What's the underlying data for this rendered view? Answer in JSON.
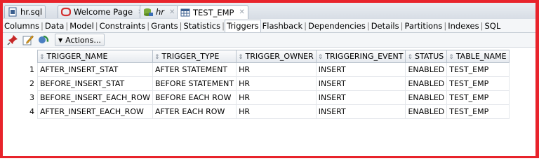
{
  "doc_tabs": [
    {
      "label": "hr.sql",
      "icon": "sql-file-icon"
    },
    {
      "label": "Welcome Page",
      "icon": "oracle-logo-icon"
    },
    {
      "label": "hr",
      "icon": "database-connection-icon"
    },
    {
      "label": "TEST_EMP",
      "icon": "table-icon"
    }
  ],
  "sub_tabs": [
    "Columns",
    "Data",
    "Model",
    "Constraints",
    "Grants",
    "Statistics",
    "Triggers",
    "Flashback",
    "Dependencies",
    "Details",
    "Partitions",
    "Indexes",
    "SQL"
  ],
  "active_sub_tab": "Triggers",
  "toolbar": {
    "actions_label": "Actions..."
  },
  "grid": {
    "columns": [
      "TRIGGER_NAME",
      "TRIGGER_TYPE",
      "TRIGGER_OWNER",
      "TRIGGERING_EVENT",
      "STATUS",
      "TABLE_NAME"
    ],
    "rows": [
      {
        "num": "1",
        "cells": [
          "AFTER_INSERT_STAT",
          "AFTER STATEMENT",
          "HR",
          "INSERT",
          "ENABLED",
          "TEST_EMP"
        ]
      },
      {
        "num": "2",
        "cells": [
          "BEFORE_INSERT_STAT",
          "BEFORE STATEMENT",
          "HR",
          "INSERT",
          "ENABLED",
          "TEST_EMP"
        ]
      },
      {
        "num": "3",
        "cells": [
          "BEFORE_INSERT_EACH_ROW",
          "BEFORE EACH ROW",
          "HR",
          "INSERT",
          "ENABLED",
          "TEST_EMP"
        ]
      },
      {
        "num": "4",
        "cells": [
          "AFTER_INSERT_EACH_ROW",
          "AFTER EACH ROW",
          "HR",
          "INSERT",
          "ENABLED",
          "TEST_EMP"
        ]
      }
    ]
  },
  "colors": {
    "highlight_border": "#e8232b",
    "header_bg": "#e5e9ee"
  }
}
